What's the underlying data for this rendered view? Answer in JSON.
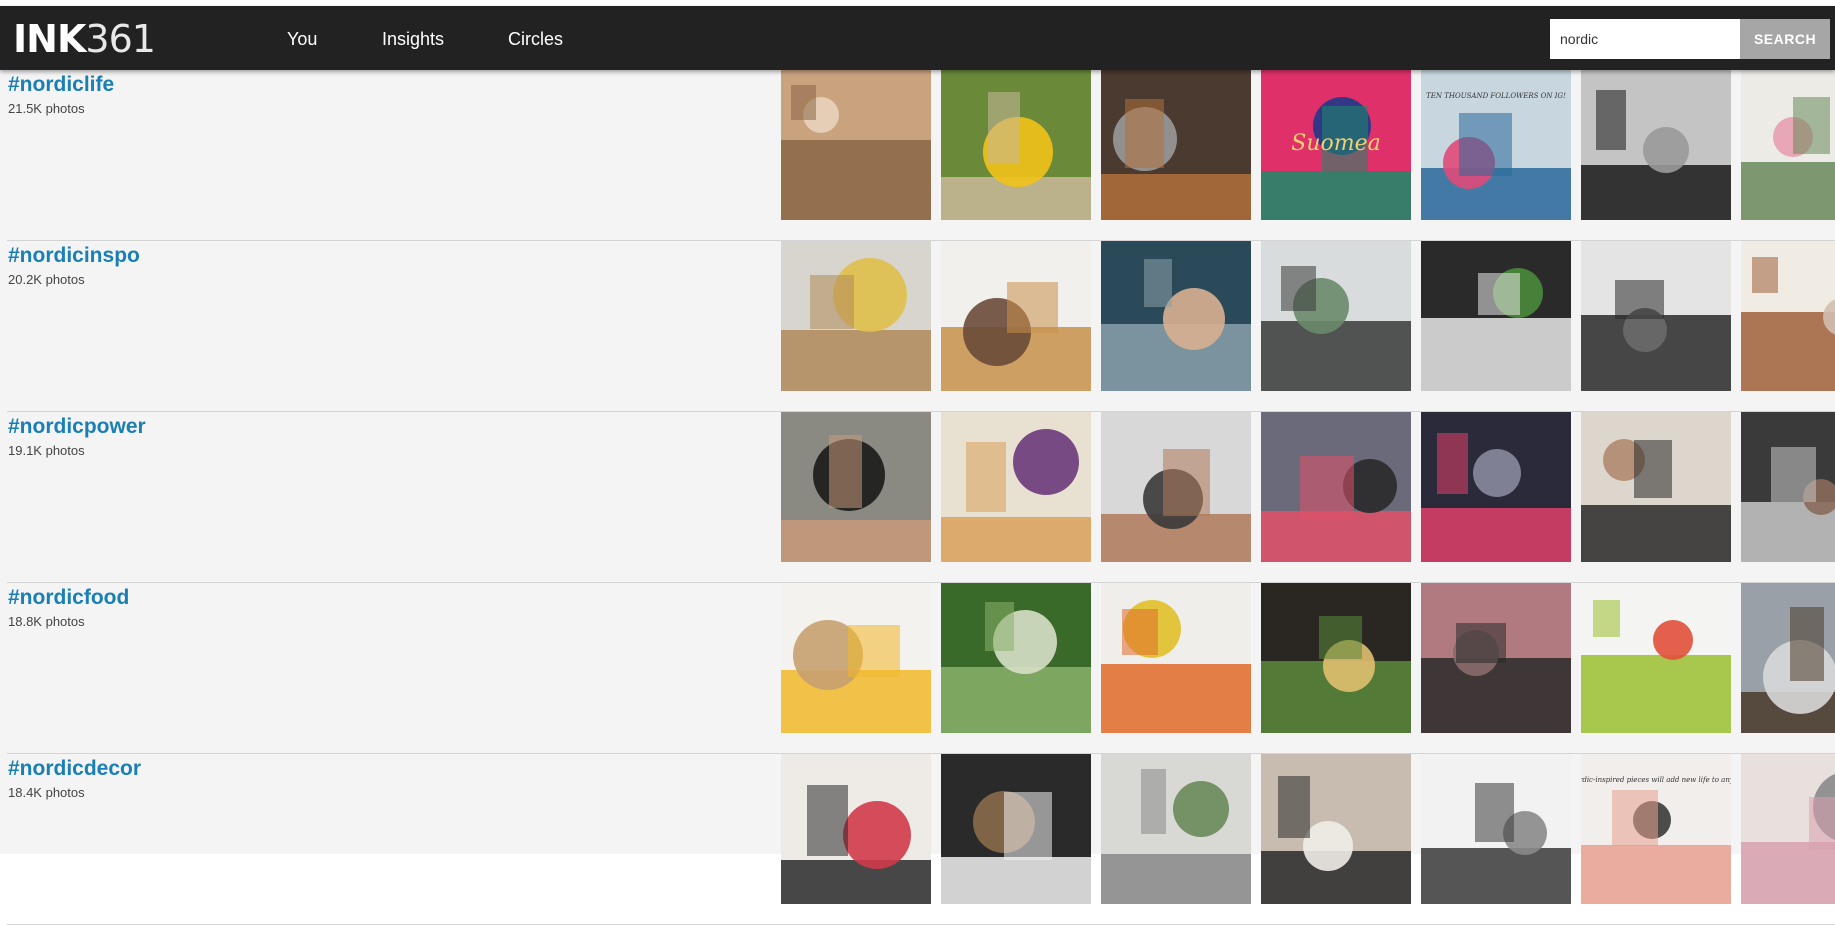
{
  "brand": {
    "bold": "INK",
    "light": "361"
  },
  "nav": [
    {
      "label": "You"
    },
    {
      "label": "Insights"
    },
    {
      "label": "Circles"
    }
  ],
  "search": {
    "value": "nordic",
    "button": "SEARCH"
  },
  "hashtags": [
    {
      "tag": "#nordiclife",
      "count": "21.5K photos",
      "photos": [
        {
          "subject": "child-feet-on-chair",
          "colors": [
            "#c9a27e",
            "#8a6645",
            "#e8d3bb"
          ]
        },
        {
          "subject": "child-in-meadow-by-gate",
          "colors": [
            "#6a8a3a",
            "#c9b89a",
            "#f2c21a"
          ]
        },
        {
          "subject": "old-town-alley",
          "colors": [
            "#4a3a30",
            "#b0703a",
            "#9a9a9a"
          ]
        },
        {
          "subject": "suomea-chocolate-bar-on-print",
          "colors": [
            "#e0306a",
            "#1a8a6a",
            "#203a8a"
          ],
          "text": "Suomea"
        },
        {
          "subject": "knitting-pattern-promo",
          "colors": [
            "#c8d6e0",
            "#2a6a9a",
            "#e04a7a"
          ],
          "text": "TEN THOUSAND FOLLOWERS ON IG!"
        },
        {
          "subject": "black-table-frame",
          "colors": [
            "#c4c4c4",
            "#1a1a1a",
            "#9a9a9a"
          ]
        },
        {
          "subject": "flowers-in-vase",
          "colors": [
            "#ecebe6",
            "#6a8a5a",
            "#e8a0b0"
          ]
        }
      ]
    },
    {
      "tag": "#nordicinspo",
      "count": "20.2K photos",
      "photos": [
        {
          "subject": "living-room-grey-sofa",
          "colors": [
            "#d8d4ce",
            "#b08a5a",
            "#e0c04a"
          ]
        },
        {
          "subject": "kids-room-shelf-teepee",
          "colors": [
            "#f2f0ec",
            "#c8904a",
            "#6a4a3a"
          ]
        },
        {
          "subject": "dotted-cushion-close-up",
          "colors": [
            "#2a4a5a",
            "#8aa0aa",
            "#d8b090"
          ]
        },
        {
          "subject": "living-room-rug",
          "colors": [
            "#d8dcdc",
            "#3a3a3a",
            "#6a8a6a"
          ]
        },
        {
          "subject": "hallway-coat-rack",
          "colors": [
            "#2a2a2a",
            "#e8e8e8",
            "#4a8a3a"
          ]
        },
        {
          "subject": "white-kitchen",
          "colors": [
            "#e4e4e4",
            "#2a2a2a",
            "#6a6a6a"
          ]
        },
        {
          "subject": "bright-room-wooden-floor",
          "colors": [
            "#f0ece4",
            "#a0603a",
            "#d0c0b0"
          ]
        }
      ]
    },
    {
      "tag": "#nordicpower",
      "count": "19.1K photos",
      "photos": [
        {
          "subject": "woman-flexing-poolside",
          "colors": [
            "#8a8a82",
            "#c89a7a",
            "#1a1a1a"
          ]
        },
        {
          "subject": "pancake-stack-berries",
          "colors": [
            "#e8e0d0",
            "#d8a05a",
            "#6a3a7a"
          ]
        },
        {
          "subject": "man-flexing-back",
          "colors": [
            "#d8d8d8",
            "#b07a5a",
            "#3a3a3a"
          ]
        },
        {
          "subject": "gym-glove-on-floor",
          "colors": [
            "#6a6a7a",
            "#e0506a",
            "#2a2a2a"
          ]
        },
        {
          "subject": "gym-pulldown-machine",
          "colors": [
            "#2a2a3a",
            "#e0406a",
            "#8a8aa0"
          ]
        },
        {
          "subject": "mirror-selfie-woman",
          "colors": [
            "#dcd6cc",
            "#2a2a2a",
            "#b08a70"
          ]
        },
        {
          "subject": "gym-rack",
          "colors": [
            "#3a3a3a",
            "#c8c8c8",
            "#8a6a5a"
          ]
        }
      ]
    },
    {
      "tag": "#nordicfood",
      "count": "18.8K photos",
      "photos": [
        {
          "subject": "orange-juice-breakfast",
          "colors": [
            "#f4f2ee",
            "#f0b82a",
            "#c8a070"
          ]
        },
        {
          "subject": "green-leaves",
          "colors": [
            "#3a6a2a",
            "#8ab06a",
            "#d8e0c8"
          ]
        },
        {
          "subject": "fruit-platter",
          "colors": [
            "#f0eeea",
            "#e06a2a",
            "#e0c02a"
          ]
        },
        {
          "subject": "candle-and-plants-table",
          "colors": [
            "#2a2622",
            "#5a8a3a",
            "#e0c070"
          ]
        },
        {
          "subject": "pink-stairwell",
          "colors": [
            "#b07a80",
            "#2a2a2a",
            "#8a6a6a"
          ]
        },
        {
          "subject": "plated-green-dish",
          "colors": [
            "#f4f4f2",
            "#9ac030",
            "#e0503a"
          ]
        },
        {
          "subject": "rye-bread-loaf",
          "colors": [
            "#9aa0a8",
            "#4a3a2a",
            "#d8d8d8"
          ]
        }
      ]
    },
    {
      "tag": "#nordicdecor",
      "count": "18.4K photos",
      "photos": [
        {
          "subject": "plant-stand-frames",
          "colors": [
            "#eeebe6",
            "#2a2a2a",
            "#d03a4a"
          ]
        },
        {
          "subject": "crib-white",
          "colors": [
            "#2a2a2a",
            "#f0f0f0",
            "#8a6a4a"
          ]
        },
        {
          "subject": "living-room-sofa",
          "colors": [
            "#d8d8d4",
            "#8a8a8a",
            "#6a8a5a"
          ]
        },
        {
          "subject": "tray-with-book-glasses",
          "colors": [
            "#c8bcb0",
            "#2a2a2a",
            "#f0ece8"
          ]
        },
        {
          "subject": "branches-in-pot",
          "colors": [
            "#f2f2f2",
            "#3a3a3a",
            "#8a8a8a"
          ]
        },
        {
          "subject": "handwritten-note-card",
          "colors": [
            "#f2eeec",
            "#e8a090",
            "#3a3a3a"
          ],
          "text": "Our Nordic-inspired pieces will add new life to any space!"
        },
        {
          "subject": "cushions-on-sofa",
          "colors": [
            "#e8e0dc",
            "#d8a0b0",
            "#8a8a8a"
          ]
        }
      ]
    }
  ]
}
